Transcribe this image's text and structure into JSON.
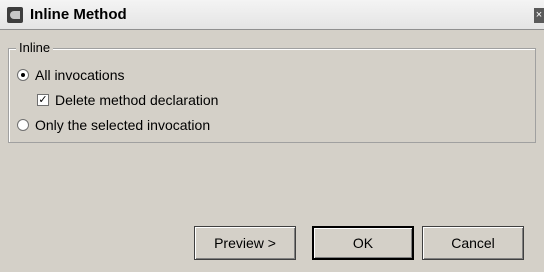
{
  "window": {
    "title": "Inline Method",
    "close_glyph": "×"
  },
  "group": {
    "label": "Inline"
  },
  "options": {
    "all_invocations": {
      "label": "All invocations",
      "selected": true
    },
    "delete_declaration": {
      "label": "Delete method declaration",
      "checked": true
    },
    "only_selected": {
      "label": "Only the selected invocation",
      "selected": false
    }
  },
  "checkbox_glyph": "✓",
  "buttons": {
    "preview": "Preview >",
    "ok": "OK",
    "cancel": "Cancel"
  },
  "icons": {
    "app": "app-icon",
    "close": "close-icon"
  },
  "colors": {
    "dialog_background": "#d4d0c8",
    "titlebar_background": "#ececec"
  }
}
